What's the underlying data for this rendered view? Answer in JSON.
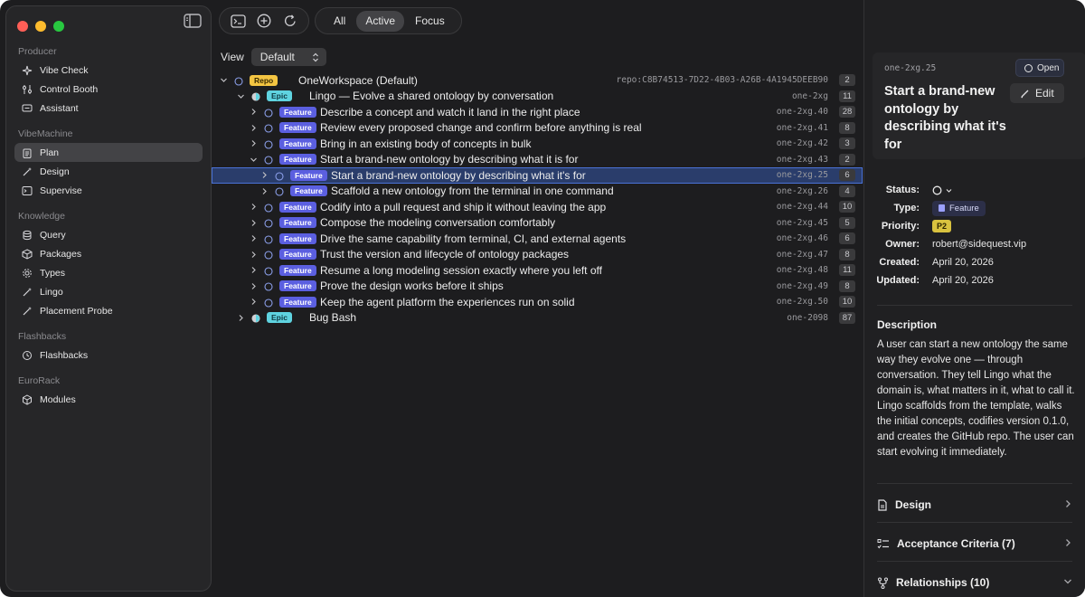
{
  "sidebar": {
    "sections": [
      {
        "label": "Producer",
        "items": [
          {
            "label": "Vibe Check",
            "icon": "sparkle-icon"
          },
          {
            "label": "Control Booth",
            "icon": "sliders-icon"
          },
          {
            "label": "Assistant",
            "icon": "chat-icon"
          }
        ]
      },
      {
        "label": "VibeMachine",
        "items": [
          {
            "label": "Plan",
            "icon": "clipboard-icon",
            "active": true
          },
          {
            "label": "Design",
            "icon": "wand-icon"
          },
          {
            "label": "Supervise",
            "icon": "terminal-icon"
          }
        ]
      },
      {
        "label": "Knowledge",
        "items": [
          {
            "label": "Query",
            "icon": "database-icon"
          },
          {
            "label": "Packages",
            "icon": "box-icon"
          },
          {
            "label": "Types",
            "icon": "gear-icon"
          },
          {
            "label": "Lingo",
            "icon": "wand-icon"
          },
          {
            "label": "Placement Probe",
            "icon": "wand-icon"
          }
        ]
      },
      {
        "label": "Flashbacks",
        "items": [
          {
            "label": "Flashbacks",
            "icon": "history-icon"
          }
        ]
      },
      {
        "label": "EuroRack",
        "items": [
          {
            "label": "Modules",
            "icon": "cube-icon"
          }
        ]
      }
    ]
  },
  "toolbar": {
    "filters": [
      "All",
      "Active",
      "Focus"
    ],
    "active_filter": "Active"
  },
  "view": {
    "label": "View",
    "selected": "Default"
  },
  "tree": [
    {
      "level": 0,
      "expanded": true,
      "status": "open",
      "badge": "Repo",
      "badge_kind": "repo",
      "title": "OneWorkspace (Default)",
      "id": "repo:C8B74513-7D22-4B03-A26B-4A1945DEEB90",
      "count": "2"
    },
    {
      "level": 1,
      "expanded": true,
      "status": "half",
      "badge": "Epic",
      "badge_kind": "epic",
      "title": "Lingo — Evolve a shared ontology by conversation",
      "id": "one-2xg",
      "count": "11"
    },
    {
      "level": 2,
      "expanded": false,
      "status": "open",
      "badge": "Feature",
      "badge_kind": "feature",
      "title": "Describe a concept and watch it land in the right place",
      "id": "one-2xg.40",
      "count": "28"
    },
    {
      "level": 2,
      "expanded": false,
      "status": "open",
      "badge": "Feature",
      "badge_kind": "feature",
      "title": "Review every proposed change and confirm before anything is real",
      "id": "one-2xg.41",
      "count": "8"
    },
    {
      "level": 2,
      "expanded": false,
      "status": "open",
      "badge": "Feature",
      "badge_kind": "feature",
      "title": "Bring in an existing body of concepts in bulk",
      "id": "one-2xg.42",
      "count": "3"
    },
    {
      "level": 2,
      "expanded": true,
      "status": "open",
      "badge": "Feature",
      "badge_kind": "feature",
      "title": "Start a brand-new ontology by describing what it is for",
      "id": "one-2xg.43",
      "count": "2"
    },
    {
      "level": 3,
      "expanded": false,
      "status": "open",
      "badge": "Feature",
      "badge_kind": "feature",
      "title": "Start a brand-new ontology by describing what it's for",
      "id": "one-2xg.25",
      "count": "6",
      "selected": true
    },
    {
      "level": 3,
      "expanded": false,
      "status": "open",
      "badge": "Feature",
      "badge_kind": "feature",
      "title": "Scaffold a new ontology from the terminal in one command",
      "id": "one-2xg.26",
      "count": "4"
    },
    {
      "level": 2,
      "expanded": false,
      "status": "open",
      "badge": "Feature",
      "badge_kind": "feature",
      "title": "Codify into a pull request and ship it without leaving the app",
      "id": "one-2xg.44",
      "count": "10"
    },
    {
      "level": 2,
      "expanded": false,
      "status": "open",
      "badge": "Feature",
      "badge_kind": "feature",
      "title": "Compose the modeling conversation comfortably",
      "id": "one-2xg.45",
      "count": "5"
    },
    {
      "level": 2,
      "expanded": false,
      "status": "open",
      "badge": "Feature",
      "badge_kind": "feature",
      "title": "Drive the same capability from terminal, CI, and external agents",
      "id": "one-2xg.46",
      "count": "6"
    },
    {
      "level": 2,
      "expanded": false,
      "status": "open",
      "badge": "Feature",
      "badge_kind": "feature",
      "title": "Trust the version and lifecycle of ontology packages",
      "id": "one-2xg.47",
      "count": "8"
    },
    {
      "level": 2,
      "expanded": false,
      "status": "open",
      "badge": "Feature",
      "badge_kind": "feature",
      "title": "Resume a long modeling session exactly where you left off",
      "id": "one-2xg.48",
      "count": "11"
    },
    {
      "level": 2,
      "expanded": false,
      "status": "open",
      "badge": "Feature",
      "badge_kind": "feature",
      "title": "Prove the design works before it ships",
      "id": "one-2xg.49",
      "count": "8"
    },
    {
      "level": 2,
      "expanded": false,
      "status": "open",
      "badge": "Feature",
      "badge_kind": "feature",
      "title": "Keep the agent platform the experiences run on solid",
      "id": "one-2xg.50",
      "count": "10"
    },
    {
      "level": 1,
      "expanded": false,
      "status": "half",
      "badge": "Epic",
      "badge_kind": "epic",
      "title": "Bug Bash",
      "id": "one-2098",
      "count": "87"
    }
  ],
  "detail": {
    "id": "one-2xg.25",
    "state": "Open",
    "title": "Start a brand-new ontology by describing what it's for",
    "edit_label": "Edit",
    "props": [
      {
        "key": "Status:",
        "kind": "status"
      },
      {
        "key": "Type:",
        "kind": "type",
        "value": "Feature"
      },
      {
        "key": "Priority:",
        "kind": "priority",
        "value": "P2"
      },
      {
        "key": "Owner:",
        "kind": "text",
        "value": "robert@sidequest.vip"
      },
      {
        "key": "Created:",
        "kind": "text",
        "value": "April 20, 2026"
      },
      {
        "key": "Updated:",
        "kind": "text",
        "value": "April 20, 2026"
      }
    ],
    "description_heading": "Description",
    "description": "A user can start a new ontology the same way they evolve one — through conversation. They tell Lingo what the domain is, what matters in it, what to call it. Lingo scaffolds from the template, walks the initial concepts, codifies version 0.1.0, and creates the GitHub repo. The user can start evolving it immediately.",
    "sections": [
      {
        "label": "Design",
        "icon": "document-icon",
        "chevron": "right"
      },
      {
        "label": "Acceptance Criteria (7)",
        "icon": "checklist-icon",
        "chevron": "right"
      },
      {
        "label": "Relationships (10)",
        "icon": "branch-icon",
        "chevron": "down"
      }
    ]
  },
  "colors": {
    "accent": "#4a72d6",
    "repo_badge": "#f4c542",
    "epic_badge": "#5fd3e0",
    "feature_badge": "#5b5fe0",
    "priority_badge": "#d9c23f"
  }
}
